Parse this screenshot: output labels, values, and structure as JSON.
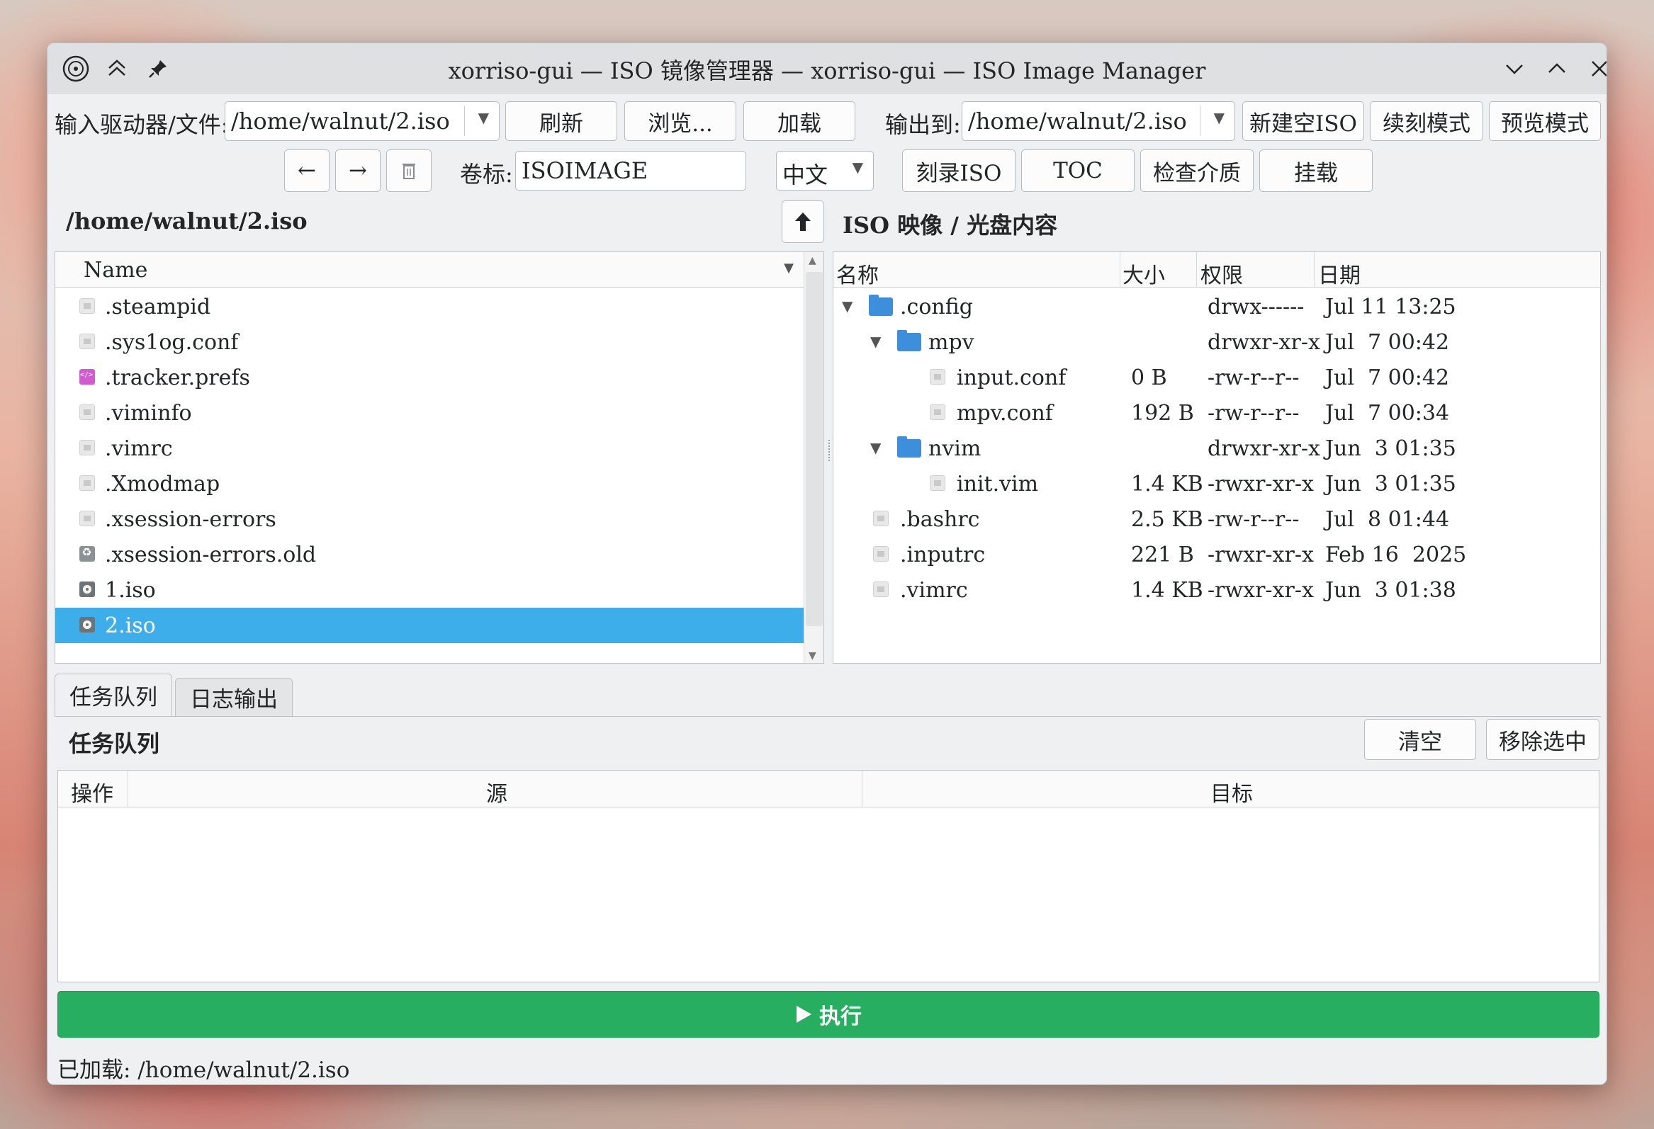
{
  "window": {
    "title": "xorriso-gui — ISO 镜像管理器 — xorriso-gui — ISO Image Manager"
  },
  "toolbar": {
    "input_label": "输入驱动器/文件:",
    "input_value": "/home/walnut/2.iso",
    "refresh": "刷新",
    "browse": "浏览...",
    "load": "加载",
    "output_label": "输出到:",
    "output_value": "/home/walnut/2.iso",
    "new_empty_iso": "新建空ISO",
    "append_mode": "续刻模式",
    "preview_mode": "预览模式",
    "back": "←",
    "forward": "→",
    "volume_label": "卷标:",
    "volume_value": "ISOIMAGE",
    "language": "中文",
    "burn_iso": "刻录ISO",
    "toc": "TOC",
    "check_media": "检查介质",
    "mount": "挂载"
  },
  "left_panel": {
    "path": "/home/walnut/2.iso",
    "column_name": "Name",
    "files": [
      {
        "name": ".steampid",
        "icon": "file"
      },
      {
        "name": ".sys1og.conf",
        "icon": "file"
      },
      {
        "name": ".tracker.prefs",
        "icon": "pref"
      },
      {
        "name": ".viminfo",
        "icon": "file"
      },
      {
        "name": ".vimrc",
        "icon": "file"
      },
      {
        "name": ".Xmodmap",
        "icon": "file"
      },
      {
        "name": ".xsession-errors",
        "icon": "file"
      },
      {
        "name": ".xsession-errors.old",
        "icon": "recycle"
      },
      {
        "name": "1.iso",
        "icon": "iso"
      },
      {
        "name": "2.iso",
        "icon": "iso",
        "selected": true
      }
    ]
  },
  "right_panel": {
    "heading": "ISO 映像 / 光盘内容",
    "columns": {
      "name": "名称",
      "size": "大小",
      "perm": "权限",
      "date": "日期"
    },
    "rows": [
      {
        "name": ".config",
        "size": "",
        "perm": "drwx------",
        "date": "Jul 11 13:25",
        "depth": 0,
        "type": "folder",
        "expanded": true
      },
      {
        "name": "mpv",
        "size": "",
        "perm": "drwxr-xr-x",
        "date": "Jul  7 00:42",
        "depth": 1,
        "type": "folder",
        "expanded": true
      },
      {
        "name": "input.conf",
        "size": "0 B",
        "perm": "-rw-r--r--",
        "date": "Jul  7 00:42",
        "depth": 2,
        "type": "file"
      },
      {
        "name": "mpv.conf",
        "size": "192 B",
        "perm": "-rw-r--r--",
        "date": "Jul  7 00:34",
        "depth": 2,
        "type": "file"
      },
      {
        "name": "nvim",
        "size": "",
        "perm": "drwxr-xr-x",
        "date": "Jun  3 01:35",
        "depth": 1,
        "type": "folder",
        "expanded": true
      },
      {
        "name": "init.vim",
        "size": "1.4 KB",
        "perm": "-rwxr-xr-x",
        "date": "Jun  3 01:35",
        "depth": 2,
        "type": "file"
      },
      {
        "name": ".bashrc",
        "size": "2.5 KB",
        "perm": "-rw-r--r--",
        "date": "Jul  8 01:44",
        "depth": 0,
        "type": "file"
      },
      {
        "name": ".inputrc",
        "size": "221 B",
        "perm": "-rwxr-xr-x",
        "date": "Feb 16  2025",
        "depth": 0,
        "type": "file"
      },
      {
        "name": ".vimrc",
        "size": "1.4 KB",
        "perm": "-rwxr-xr-x",
        "date": "Jun  3 01:38",
        "depth": 0,
        "type": "file"
      }
    ]
  },
  "tabs": {
    "task_queue": "任务队列",
    "log_output": "日志输出"
  },
  "queue": {
    "heading": "任务队列",
    "clear": "清空",
    "remove_selected": "移除选中",
    "col_op": "操作",
    "col_source": "源",
    "col_target": "目标"
  },
  "execute": {
    "label": "执行"
  },
  "status": {
    "text": "已加载: /home/walnut/2.iso"
  }
}
